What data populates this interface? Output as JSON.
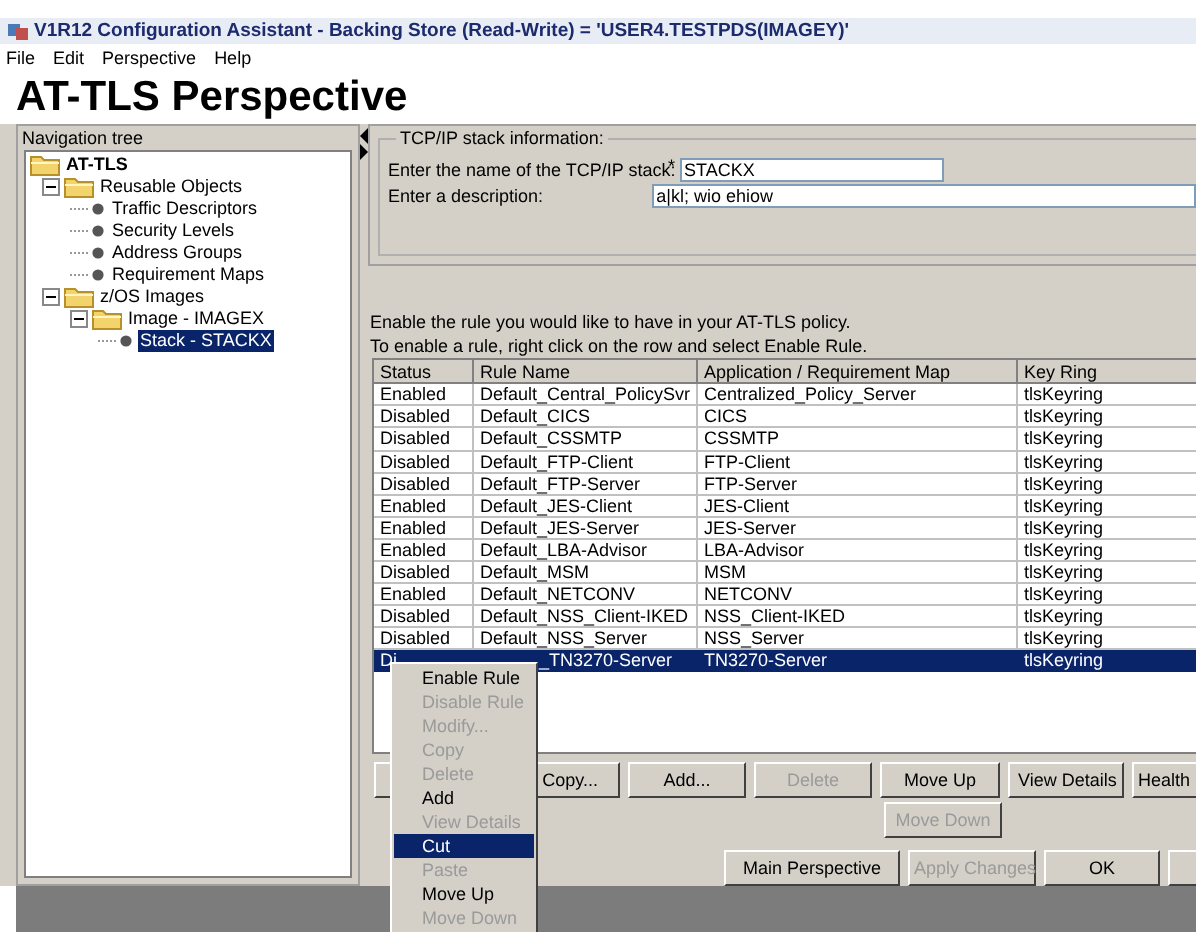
{
  "window": {
    "title": "V1R12 Configuration Assistant - Backing Store (Read-Write) = 'USER4.TESTPDS(IMAGEY)'"
  },
  "menu": [
    {
      "label": "File"
    },
    {
      "label": "Edit"
    },
    {
      "label": "Perspective"
    },
    {
      "label": "Help"
    }
  ],
  "heading": "AT-TLS Perspective",
  "navigation": {
    "title": "Navigation tree",
    "items": [
      {
        "label": "AT-TLS",
        "kind": "folder",
        "selected": false,
        "children": [
          {
            "label": "Reusable Objects",
            "kind": "folder",
            "expanded": true,
            "selected": false,
            "children": [
              {
                "label": "Traffic Descriptors",
                "kind": "leaf",
                "selected": false
              },
              {
                "label": "Security Levels",
                "kind": "leaf",
                "selected": false
              },
              {
                "label": "Address Groups",
                "kind": "leaf",
                "selected": false
              },
              {
                "label": "Requirement Maps",
                "kind": "leaf",
                "selected": false
              }
            ]
          },
          {
            "label": "z/OS Images",
            "kind": "folder",
            "expanded": true,
            "selected": false,
            "children": [
              {
                "label": "Image - IMAGEX",
                "kind": "folder",
                "expanded": true,
                "selected": false,
                "children": [
                  {
                    "label": "Stack - STACKX",
                    "kind": "leaf",
                    "selected": true
                  }
                ]
              }
            ]
          }
        ]
      }
    ]
  },
  "stack_info": {
    "legend": "TCP/IP stack information:",
    "fields": [
      {
        "label": "Enter the name of the TCP/IP stack:",
        "required_mark": "*",
        "value": "STACKX",
        "kind": "short"
      },
      {
        "label": "Enter a description:",
        "value": "a|kl; wio ehiow",
        "kind": "long"
      }
    ]
  },
  "instructions": [
    "Enable the rule you would like to have in your AT-TLS policy.",
    "To enable a rule, right click on the row and select Enable Rule."
  ],
  "table": {
    "columns": [
      "Status",
      "Rule Name",
      "Application / Requirement Map",
      "Key Ring"
    ],
    "rows": [
      {
        "cells": [
          "Enabled",
          "Default_Central_PolicySvr",
          "Centralized_Policy_Server",
          "tlsKeyring"
        ],
        "selected": false
      },
      {
        "cells": [
          "Disabled",
          "Default_CICS",
          "CICS",
          "tlsKeyring"
        ],
        "selected": false
      },
      {
        "cells": [
          "Disabled",
          "Default_CSSMTP",
          "CSSMTP",
          "tlsKeyring"
        ],
        "selected": false
      },
      {
        "cells": [
          "Disabled",
          "Default_FTP-Client",
          "FTP-Client",
          "tlsKeyring"
        ],
        "selected": false
      },
      {
        "cells": [
          "Disabled",
          "Default_FTP-Server",
          "FTP-Server",
          "tlsKeyring"
        ],
        "selected": false
      },
      {
        "cells": [
          "Enabled",
          "Default_JES-Client",
          "JES-Client",
          "tlsKeyring"
        ],
        "selected": false
      },
      {
        "cells": [
          "Enabled",
          "Default_JES-Server",
          "JES-Server",
          "tlsKeyring"
        ],
        "selected": false
      },
      {
        "cells": [
          "Enabled",
          "Default_LBA-Advisor",
          "LBA-Advisor",
          "tlsKeyring"
        ],
        "selected": false
      },
      {
        "cells": [
          "Disabled",
          "Default_MSM",
          "MSM",
          "tlsKeyring"
        ],
        "selected": false
      },
      {
        "cells": [
          "Enabled",
          "Default_NETCONV",
          "NETCONV",
          "tlsKeyring"
        ],
        "selected": false
      },
      {
        "cells": [
          "Disabled",
          "Default_NSS_Client-IKED",
          "NSS_Client-IKED",
          "tlsKeyring"
        ],
        "selected": false
      },
      {
        "cells": [
          "Disabled",
          "Default_NSS_Server",
          "NSS_Server",
          "tlsKeyring"
        ],
        "selected": false
      },
      {
        "cells": [
          "Di",
          "_TN3270-Server",
          "TN3270-Server",
          "tlsKeyring"
        ],
        "selected": true
      }
    ]
  },
  "buttons": [
    {
      "label": "Copy...",
      "disabled": false
    },
    {
      "label": "Add...",
      "disabled": false
    },
    {
      "label": "Delete",
      "disabled": true
    },
    {
      "label": "Move Up",
      "disabled": false
    },
    {
      "label": "View Details",
      "disabled": false
    },
    {
      "label": "Health",
      "disabled": false
    }
  ],
  "buttons_second_row": [
    {
      "label": "Move Down",
      "disabled": true
    }
  ],
  "dialog_buttons": [
    {
      "label": "Main Perspective",
      "disabled": false
    },
    {
      "label": "Apply Changes",
      "disabled": true
    },
    {
      "label": "OK",
      "disabled": false
    }
  ],
  "context_menu": [
    {
      "label": "Enable Rule",
      "disabled": false,
      "selected": false
    },
    {
      "label": "Disable Rule",
      "disabled": true,
      "selected": false
    },
    {
      "label": "Modify...",
      "disabled": true,
      "selected": false
    },
    {
      "label": "Copy",
      "disabled": true,
      "selected": false
    },
    {
      "label": "Delete",
      "disabled": true,
      "selected": false
    },
    {
      "label": "Add",
      "disabled": false,
      "selected": false
    },
    {
      "label": "View Details",
      "disabled": true,
      "selected": false
    },
    {
      "label": "Cut",
      "disabled": false,
      "selected": true
    },
    {
      "label": "Paste",
      "disabled": true,
      "selected": false
    },
    {
      "label": "Move Up",
      "disabled": false,
      "selected": false
    },
    {
      "label": "Move Down",
      "disabled": true,
      "selected": false
    }
  ]
}
